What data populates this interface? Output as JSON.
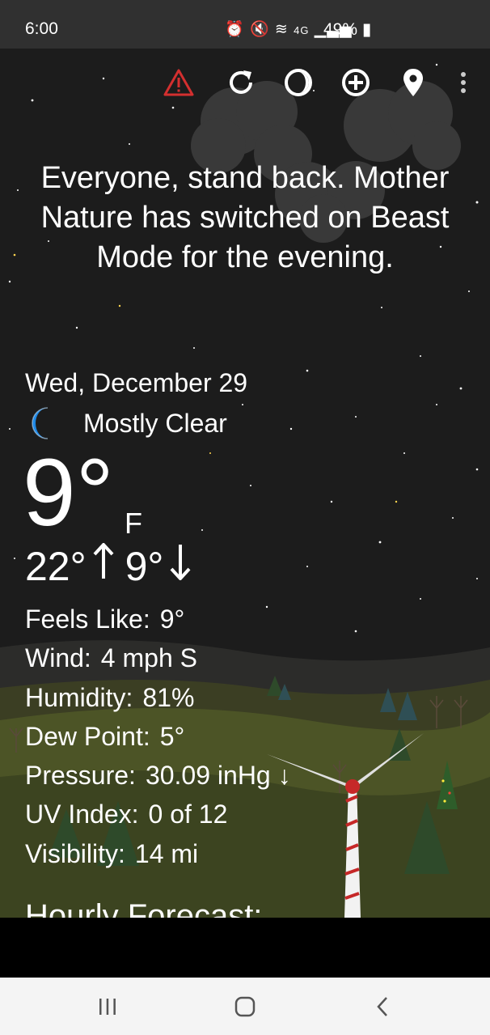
{
  "status_bar": {
    "time": "6:00",
    "icons": [
      "alarm-icon",
      "mute-icon",
      "wifi-icon",
      "4g-icon",
      "signal-icon"
    ],
    "network_label": "4G",
    "battery_percent": "49%"
  },
  "toolbar": {
    "items": [
      "warning-icon",
      "refresh-icon",
      "moon-phase-icon",
      "add-location-icon",
      "location-pin-icon",
      "more-vert-icon"
    ],
    "warning_color": "#d32f2f"
  },
  "headline": "Everyone, stand back. Mother Nature has switched on Beast Mode for the evening.",
  "current": {
    "date": "Wed, December 29",
    "condition": "Mostly Clear",
    "condition_icon": "moon-icon",
    "temperature": "9°",
    "unit": "F",
    "high": "22°",
    "low": "9°"
  },
  "details": [
    {
      "label": "Feels Like:",
      "value": "9°"
    },
    {
      "label": "Wind:",
      "value": "4 mph S"
    },
    {
      "label": "Humidity:",
      "value": "81%"
    },
    {
      "label": "Dew Point:",
      "value": "5°"
    },
    {
      "label": "Pressure:",
      "value": "30.09 inHg ↓"
    },
    {
      "label": "UV Index:",
      "value": "0 of 12"
    },
    {
      "label": "Visibility:",
      "value": "14 mi"
    }
  ],
  "hourly_title": "Hourly Forecast:",
  "nav": [
    "recent-apps-icon",
    "home-icon",
    "back-icon"
  ],
  "colors": {
    "sky": "#1c1c1c",
    "moon": "#1e88e5",
    "nav_bg": "#f4f4f4"
  }
}
